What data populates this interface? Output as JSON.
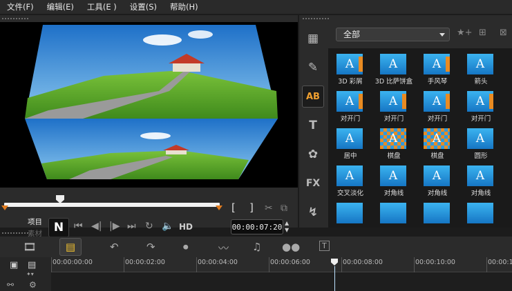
{
  "menu": [
    "文件(F)",
    "编辑(E)",
    "工具(E )",
    "设置(S)",
    "帮助(H)"
  ],
  "player": {
    "label_project": "项目",
    "label_clip": "素材",
    "play_glyph": "N",
    "hd": "HD",
    "timecode": "00:00:07:20",
    "mark_in": "[",
    "mark_out": "]"
  },
  "library": {
    "category": "全部",
    "tab_title": "AB",
    "tab_text": "T",
    "tab_fx": "FX",
    "items": [
      {
        "label": "3D 彩屑",
        "thumb": "A"
      },
      {
        "label": "3D 比萨饼盒",
        "thumb": "A"
      },
      {
        "label": "手风琴",
        "thumb": "A"
      },
      {
        "label": "箭头",
        "thumb": "A"
      },
      {
        "label": "对开门",
        "thumb": "A"
      },
      {
        "label": "对开门",
        "thumb": "A"
      },
      {
        "label": "对开门",
        "thumb": "A"
      },
      {
        "label": "对开门",
        "thumb": "A"
      },
      {
        "label": "居中",
        "thumb": "A"
      },
      {
        "label": "棋盘",
        "thumb": "A"
      },
      {
        "label": "棋盘",
        "thumb": "A"
      },
      {
        "label": "圆形",
        "thumb": "A"
      },
      {
        "label": "交叉淡化",
        "thumb": "A"
      },
      {
        "label": "对角线",
        "thumb": "A"
      },
      {
        "label": "对角线",
        "thumb": "A"
      },
      {
        "label": "对角线",
        "thumb": "A"
      }
    ]
  },
  "timeline": {
    "ticks": [
      "00:00:00:00",
      "00:00:02:00",
      "00:00:04:00",
      "00:00:06:00",
      "00:00:08:00",
      "00:00:10:00",
      "00:00:12"
    ],
    "title_tool": "T"
  },
  "colors": {
    "accent_blue": "#2c9ae0",
    "accent_orange": "#e98b22"
  }
}
